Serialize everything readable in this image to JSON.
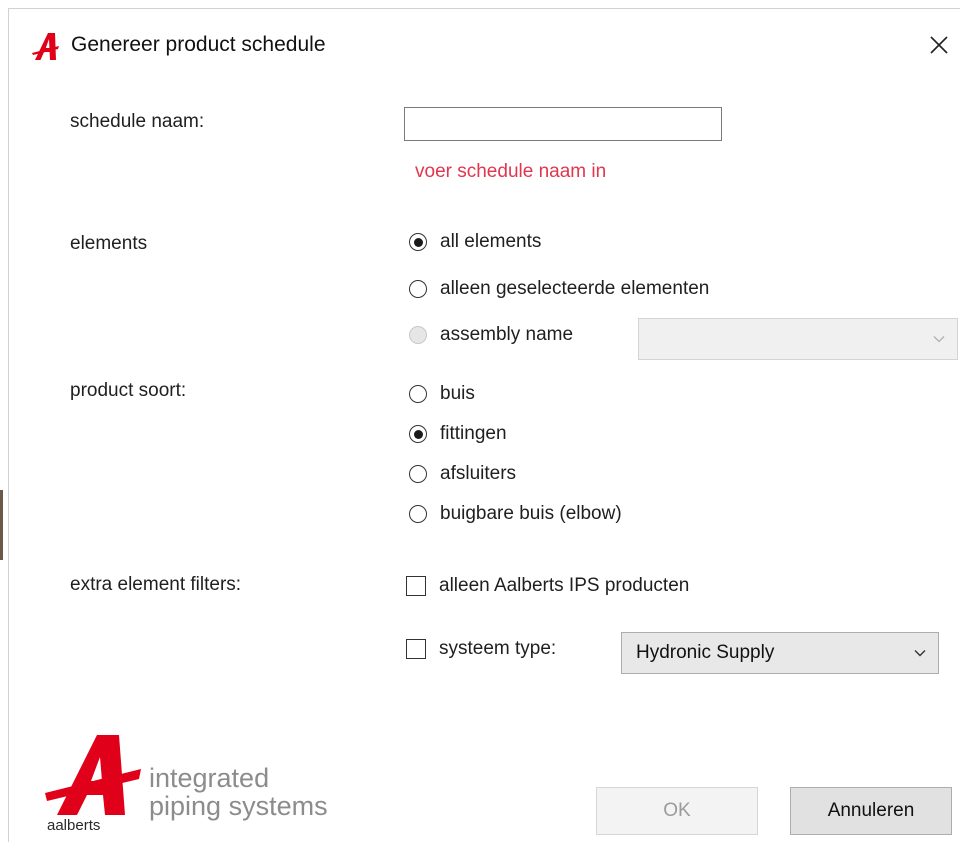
{
  "window": {
    "title": "Genereer product schedule",
    "close_glyph": "✕"
  },
  "form": {
    "schedule_name": {
      "label": "schedule naam:",
      "value": "",
      "placeholder": "",
      "error": "voer schedule naam in"
    },
    "elements": {
      "label": "elements",
      "options": [
        "all elements",
        "alleen geselecteerde elementen",
        "assembly name"
      ],
      "selected_index": 0,
      "disabled_index": 2,
      "assembly_combo_value": ""
    },
    "product_soort": {
      "label": "product soort:",
      "options": [
        "buis",
        "fittingen",
        "afsluiters",
        "buigbare buis (elbow)"
      ],
      "selected_index": 1
    },
    "extra_filters": {
      "label": "extra element filters:",
      "only_aalberts_label": "alleen Aalberts IPS producten",
      "only_aalberts_checked": false,
      "system_type_label": "systeem type:",
      "system_type_checked": false,
      "system_type_value": "Hydronic Supply"
    }
  },
  "buttons": {
    "ok": "OK",
    "cancel": "Annuleren"
  },
  "brand": {
    "line1": "integrated",
    "line2": "piping systems",
    "small": "aalberts"
  },
  "colors": {
    "brand_red": "#e1001a",
    "error_red": "#e0364f"
  },
  "icons": {
    "title_logo": "aalberts-a-logo-icon",
    "close": "close-icon",
    "dropdown": "chevron-down-icon"
  }
}
